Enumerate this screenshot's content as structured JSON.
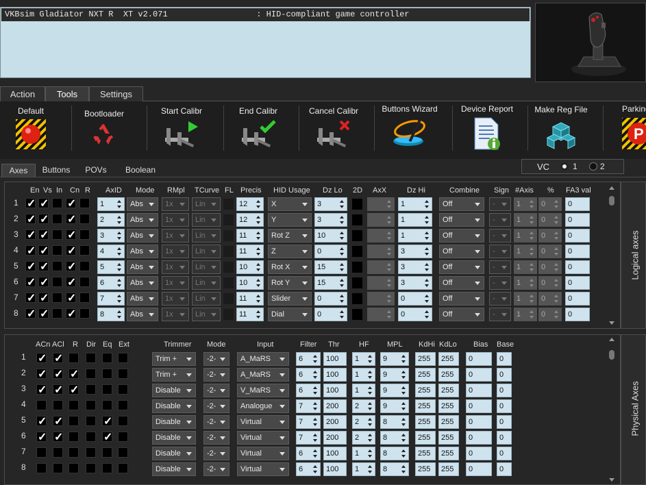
{
  "device": {
    "selected": "VKBsim Gladiator NXT R  XT v2.071                  : HID-compliant game controller"
  },
  "tabs": [
    "Action",
    "Tools",
    "Settings"
  ],
  "active_tab": "Tools",
  "tools": [
    {
      "label": "Default",
      "icon": "default-red-button-icon"
    },
    {
      "label": "Bootloader",
      "icon": "recycle-icon"
    },
    {
      "label": "Start Calibr",
      "icon": "caliper-play-icon"
    },
    {
      "label": "End Calibr",
      "icon": "caliper-check-icon"
    },
    {
      "label": "Cancel Calibr",
      "icon": "caliper-cross-icon"
    },
    {
      "label": "Buttons Wizard",
      "icon": "magic-wand-icon"
    },
    {
      "label": "Device Report",
      "icon": "report-document-icon"
    },
    {
      "label": "Make Reg File",
      "icon": "registry-cubes-icon"
    },
    {
      "label": "Parking",
      "icon": "parking-icon"
    }
  ],
  "subtabs": [
    "Axes",
    "Buttons",
    "POVs",
    "Boolean"
  ],
  "vc": {
    "label": "VC",
    "options": [
      "1",
      "2"
    ],
    "selected": "1"
  },
  "logical": {
    "side_label": "Logical axes",
    "headers": {
      "en": "En",
      "vs": "Vs",
      "in": "In",
      "cn": "Cn",
      "r": "R",
      "axid": "AxID",
      "mode": "Mode",
      "rmpl": "RMpl",
      "tcurve": "TCurve",
      "fl": "FL",
      "precis": "Precis",
      "hid": "HID Usage",
      "dzlo": "Dz Lo",
      "twod": "2D",
      "axx": "AxX",
      "dzhi": "Dz Hi",
      "combine": "Combine",
      "sign": "Sign",
      "naxis": "#Axis",
      "pct": "%",
      "fa3": "FA3 val"
    },
    "rows": [
      {
        "n": "1",
        "en": true,
        "vs": true,
        "in": false,
        "cn": true,
        "r": false,
        "axid": "1",
        "mode": "Abs",
        "rmpl": "1x",
        "tcurve": "Lin",
        "precis": "12",
        "hid": "X",
        "dzlo": "3",
        "dzhi": "1",
        "combine": "Off",
        "sign": "-",
        "naxis": "1",
        "pct": "0",
        "fa3": "0"
      },
      {
        "n": "2",
        "en": true,
        "vs": true,
        "in": false,
        "cn": true,
        "r": false,
        "axid": "2",
        "mode": "Abs",
        "rmpl": "1x",
        "tcurve": "Lin",
        "precis": "12",
        "hid": "Y",
        "dzlo": "3",
        "dzhi": "1",
        "combine": "Off",
        "sign": "-",
        "naxis": "1",
        "pct": "0",
        "fa3": "0"
      },
      {
        "n": "3",
        "en": true,
        "vs": true,
        "in": false,
        "cn": true,
        "r": false,
        "axid": "3",
        "mode": "Abs",
        "rmpl": "1x",
        "tcurve": "Lin",
        "precis": "11",
        "hid": "Rot Z",
        "dzlo": "10",
        "dzhi": "1",
        "combine": "Off",
        "sign": "-",
        "naxis": "1",
        "pct": "0",
        "fa3": "0"
      },
      {
        "n": "4",
        "en": true,
        "vs": true,
        "in": false,
        "cn": true,
        "r": false,
        "axid": "4",
        "mode": "Abs",
        "rmpl": "1x",
        "tcurve": "Lin",
        "precis": "11",
        "hid": "Z",
        "dzlo": "0",
        "dzhi": "3",
        "combine": "Off",
        "sign": "-",
        "naxis": "1",
        "pct": "0",
        "fa3": "0"
      },
      {
        "n": "5",
        "en": true,
        "vs": true,
        "in": false,
        "cn": true,
        "r": false,
        "axid": "5",
        "mode": "Abs",
        "rmpl": "1x",
        "tcurve": "Lin",
        "precis": "10",
        "hid": "Rot X",
        "dzlo": "15",
        "dzhi": "3",
        "combine": "Off",
        "sign": "-",
        "naxis": "1",
        "pct": "0",
        "fa3": "0"
      },
      {
        "n": "6",
        "en": true,
        "vs": true,
        "in": false,
        "cn": true,
        "r": false,
        "axid": "6",
        "mode": "Abs",
        "rmpl": "1x",
        "tcurve": "Lin",
        "precis": "10",
        "hid": "Rot Y",
        "dzlo": "15",
        "dzhi": "3",
        "combine": "Off",
        "sign": "-",
        "naxis": "1",
        "pct": "0",
        "fa3": "0"
      },
      {
        "n": "7",
        "en": true,
        "vs": true,
        "in": false,
        "cn": true,
        "r": false,
        "axid": "7",
        "mode": "Abs",
        "rmpl": "1x",
        "tcurve": "Lin",
        "precis": "11",
        "hid": "Slider",
        "dzlo": "0",
        "dzhi": "0",
        "combine": "Off",
        "sign": "-",
        "naxis": "1",
        "pct": "0",
        "fa3": "0"
      },
      {
        "n": "8",
        "en": true,
        "vs": true,
        "in": false,
        "cn": true,
        "r": false,
        "axid": "8",
        "mode": "Abs",
        "rmpl": "1x",
        "tcurve": "Lin",
        "precis": "11",
        "hid": "Dial",
        "dzlo": "0",
        "dzhi": "0",
        "combine": "Off",
        "sign": "-",
        "naxis": "1",
        "pct": "0",
        "fa3": "0"
      }
    ]
  },
  "physical": {
    "side_label": "Physical Axes",
    "headers": {
      "acn": "ACn",
      "acl": "ACl",
      "r": "R",
      "dir": "Dir",
      "eq": "Eq",
      "ext": "Ext",
      "trimmer": "Trimmer",
      "mode": "Mode",
      "input": "Input",
      "filter": "Filter",
      "thr": "Thr",
      "hf": "HF",
      "mpl": "MPL",
      "kdhi": "KdHi",
      "kdlo": "KdLo",
      "bias": "Bias",
      "base": "Base"
    },
    "rows": [
      {
        "n": "1",
        "acn": true,
        "acl": true,
        "r": false,
        "dir": false,
        "eq": false,
        "ext": false,
        "trimmer": "Trim +",
        "mode": "-2-",
        "input": "A_MaRS",
        "filter": "6",
        "thr": "100",
        "hf": "1",
        "mpl": "9",
        "kdhi": "255",
        "kdlo": "255",
        "bias": "0",
        "base": "0"
      },
      {
        "n": "2",
        "acn": true,
        "acl": true,
        "r": true,
        "dir": false,
        "eq": false,
        "ext": false,
        "trimmer": "Trim +",
        "mode": "-2-",
        "input": "A_MaRS",
        "filter": "6",
        "thr": "100",
        "hf": "1",
        "mpl": "9",
        "kdhi": "255",
        "kdlo": "255",
        "bias": "0",
        "base": "0"
      },
      {
        "n": "3",
        "acn": true,
        "acl": true,
        "r": true,
        "dir": false,
        "eq": false,
        "ext": false,
        "trimmer": "Disable",
        "mode": "-2-",
        "input": "V_MaRS",
        "filter": "6",
        "thr": "100",
        "hf": "1",
        "mpl": "9",
        "kdhi": "255",
        "kdlo": "255",
        "bias": "0",
        "base": "0"
      },
      {
        "n": "4",
        "acn": false,
        "acl": false,
        "r": false,
        "dir": false,
        "eq": false,
        "ext": false,
        "trimmer": "Disable",
        "mode": "-2-",
        "input": "Analogue",
        "filter": "7",
        "thr": "200",
        "hf": "2",
        "mpl": "9",
        "kdhi": "255",
        "kdlo": "255",
        "bias": "0",
        "base": "0"
      },
      {
        "n": "5",
        "acn": true,
        "acl": true,
        "r": false,
        "dir": false,
        "eq": true,
        "ext": false,
        "trimmer": "Disable",
        "mode": "-2-",
        "input": "Virtual",
        "filter": "7",
        "thr": "200",
        "hf": "2",
        "mpl": "8",
        "kdhi": "255",
        "kdlo": "255",
        "bias": "0",
        "base": "0"
      },
      {
        "n": "6",
        "acn": true,
        "acl": true,
        "r": false,
        "dir": false,
        "eq": true,
        "ext": false,
        "trimmer": "Disable",
        "mode": "-2-",
        "input": "Virtual",
        "filter": "7",
        "thr": "200",
        "hf": "2",
        "mpl": "8",
        "kdhi": "255",
        "kdlo": "255",
        "bias": "0",
        "base": "0"
      },
      {
        "n": "7",
        "acn": false,
        "acl": false,
        "r": false,
        "dir": false,
        "eq": false,
        "ext": false,
        "trimmer": "Disable",
        "mode": "-2-",
        "input": "Virtual",
        "filter": "6",
        "thr": "100",
        "hf": "1",
        "mpl": "8",
        "kdhi": "255",
        "kdlo": "255",
        "bias": "0",
        "base": "0"
      },
      {
        "n": "8",
        "acn": false,
        "acl": false,
        "r": false,
        "dir": false,
        "eq": false,
        "ext": false,
        "trimmer": "Disable",
        "mode": "-2-",
        "input": "Virtual",
        "filter": "6",
        "thr": "100",
        "hf": "1",
        "mpl": "8",
        "kdhi": "255",
        "kdlo": "255",
        "bias": "0",
        "base": "0"
      }
    ]
  },
  "colors": {
    "background": "#262626",
    "field": "#cfe3ee",
    "checkbox": "#000000"
  }
}
